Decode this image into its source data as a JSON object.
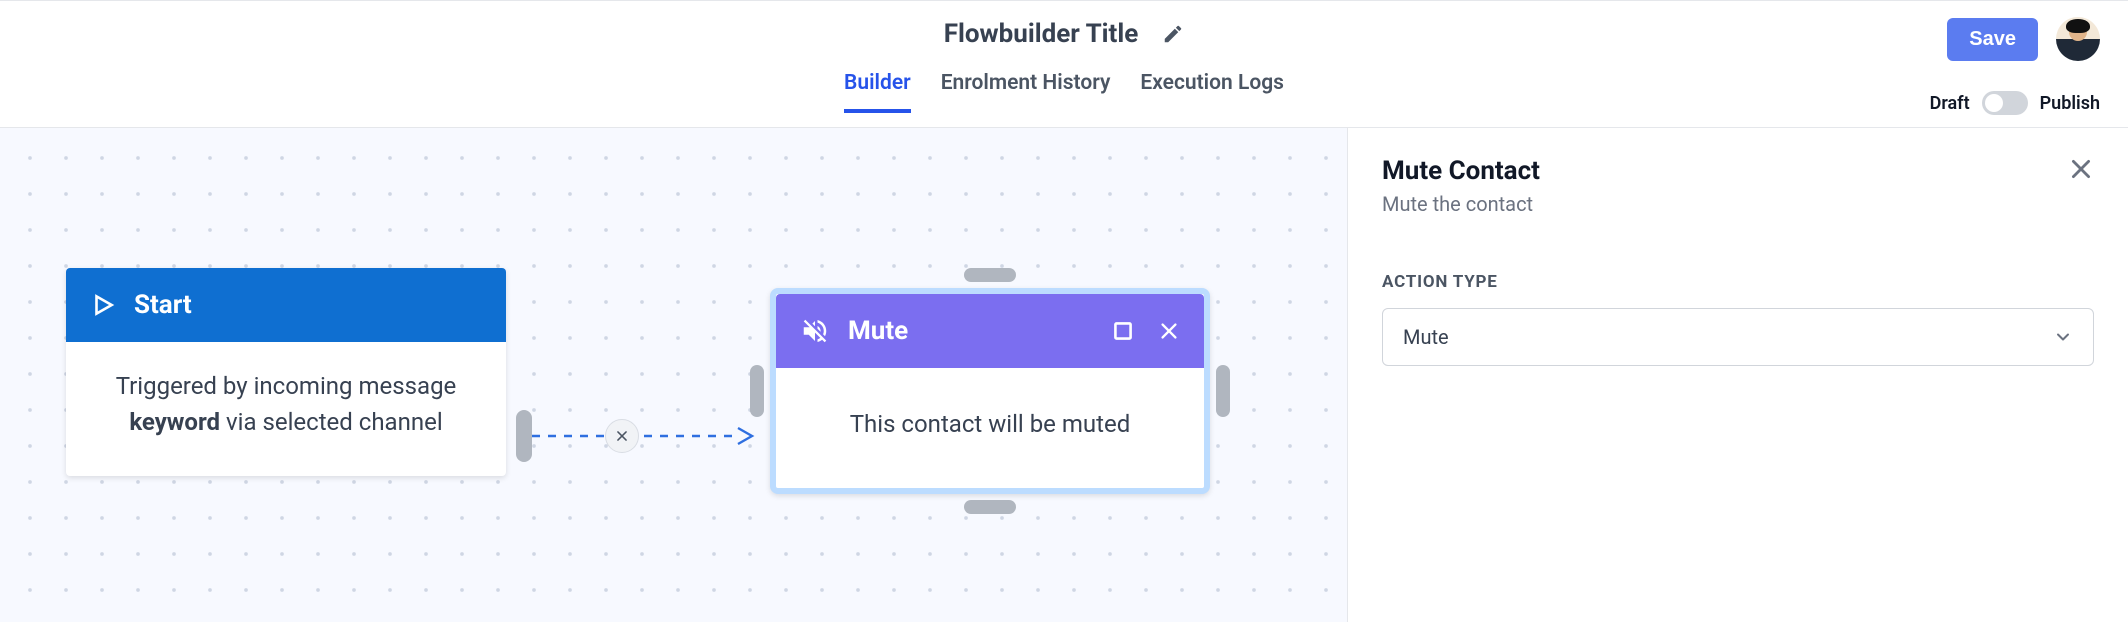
{
  "header": {
    "title": "Flowbuilder Title",
    "tabs": [
      {
        "label": "Builder",
        "active": true
      },
      {
        "label": "Enrolment History",
        "active": false
      },
      {
        "label": "Execution Logs",
        "active": false
      }
    ],
    "save_label": "Save",
    "draft_label": "Draft",
    "publish_label": "Publish"
  },
  "nodes": {
    "start": {
      "title": "Start",
      "body_prefix": "Triggered by incoming message ",
      "body_keyword": "keyword",
      "body_suffix": " via selected channel"
    },
    "mute": {
      "title": "Mute",
      "body": "This contact will be muted"
    }
  },
  "sidepanel": {
    "title": "Mute Contact",
    "subtitle": "Mute the contact",
    "section_label": "ACTION TYPE",
    "select_value": "Mute"
  },
  "colors": {
    "primary_blue": "#2653ea",
    "start_header": "#0f6fd1",
    "mute_header": "#7b6ef0",
    "selection_ring": "#bcdcff",
    "save_btn": "#5b7cf0"
  }
}
